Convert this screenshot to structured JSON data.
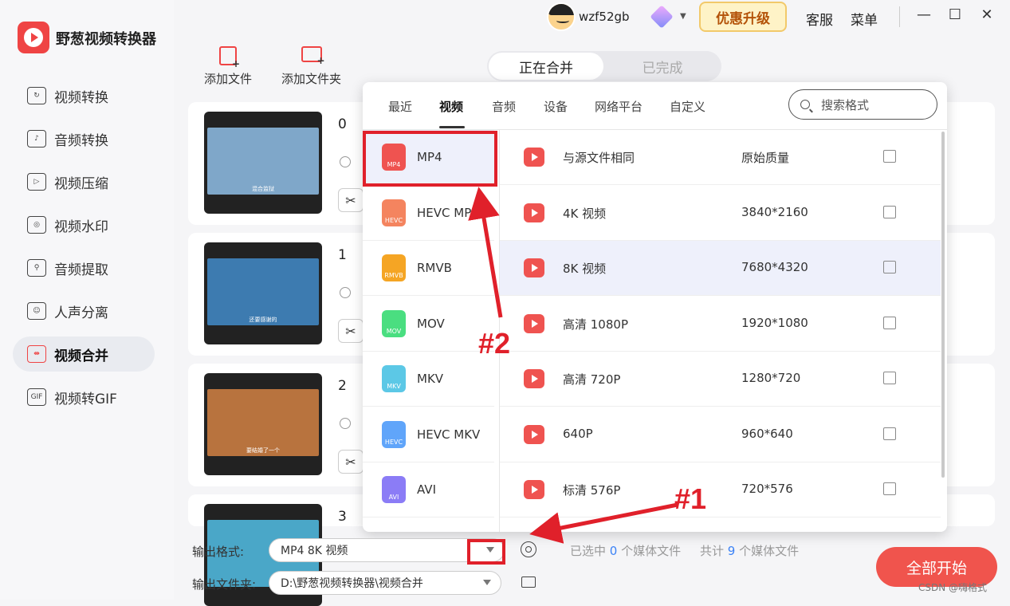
{
  "app": {
    "title": "野葱视频转换器"
  },
  "sidebar": {
    "items": [
      {
        "label": "视频转换",
        "icon": "video-convert-icon",
        "glyph": "↻"
      },
      {
        "label": "音频转换",
        "icon": "audio-convert-icon",
        "glyph": "♪"
      },
      {
        "label": "视频压缩",
        "icon": "video-compress-icon",
        "glyph": "▷"
      },
      {
        "label": "视频水印",
        "icon": "video-watermark-icon",
        "glyph": "◎"
      },
      {
        "label": "音频提取",
        "icon": "audio-extract-icon",
        "glyph": "⚲"
      },
      {
        "label": "人声分离",
        "icon": "voice-separate-icon",
        "glyph": "☺"
      },
      {
        "label": "视频合并",
        "icon": "video-merge-icon",
        "glyph": "⇹"
      },
      {
        "label": "视频转GIF",
        "icon": "gif-icon",
        "glyph": "GIF"
      }
    ],
    "active_index": 6
  },
  "titlebar": {
    "username": "wzf52gb",
    "vip_label": "优惠升级",
    "service_label": "客服",
    "menu_label": "菜单",
    "minimize": "—",
    "maximize": "☐",
    "close": "✕"
  },
  "toolbar": {
    "add_file": "添加文件",
    "add_folder": "添加文件夹"
  },
  "segment": {
    "merging": "正在合并",
    "done": "已完成"
  },
  "cards": [
    {
      "index": "0",
      "subtitle": "混合监狱"
    },
    {
      "index": "1",
      "subtitle": "还要感谢的"
    },
    {
      "index": "2",
      "subtitle": "要结婚了一个"
    },
    {
      "index": "3",
      "subtitle": ""
    }
  ],
  "popup": {
    "tabs": [
      "最近",
      "视频",
      "音频",
      "设备",
      "网络平台",
      "自定义"
    ],
    "active_tab": "视频",
    "search_placeholder": "搜索格式",
    "formats": [
      {
        "label": "MP4",
        "badge": "MP4",
        "color": "#ef5350"
      },
      {
        "label": "HEVC MP4",
        "badge": "HEVC",
        "color": "#f4845f"
      },
      {
        "label": "RMVB",
        "badge": "RMVB",
        "color": "#f5a524"
      },
      {
        "label": "MOV",
        "badge": "MOV",
        "color": "#4ade80"
      },
      {
        "label": "MKV",
        "badge": "MKV",
        "color": "#5cc8e6"
      },
      {
        "label": "HEVC MKV",
        "badge": "HEVC",
        "color": "#60a5fa"
      },
      {
        "label": "AVI",
        "badge": "AVI",
        "color": "#8b7cf6"
      }
    ],
    "selected_format": "MP4",
    "qualities": [
      {
        "name": "与源文件相同",
        "res": "原始质量"
      },
      {
        "name": "4K 视频",
        "res": "3840*2160"
      },
      {
        "name": "8K 视频",
        "res": "7680*4320"
      },
      {
        "name": "高清 1080P",
        "res": "1920*1080"
      },
      {
        "name": "高清 720P",
        "res": "1280*720"
      },
      {
        "name": "640P",
        "res": "960*640"
      },
      {
        "name": "标清 576P",
        "res": "720*576"
      }
    ],
    "highlighted_quality": "8K 视频"
  },
  "bottom": {
    "format_label": "输出格式:",
    "format_value": "MP4 8K 视频",
    "folder_label": "输出文件夹:",
    "folder_value": "D:\\野葱视频转换器\\视频合并",
    "selected_prefix": "已选中",
    "selected_count": "0",
    "selected_suffix": "个媒体文件",
    "total_prefix": "共计",
    "total_count": "9",
    "total_suffix": "个媒体文件",
    "start_label": "全部开始"
  },
  "annotations": {
    "label_1": "#1",
    "label_2": "#2",
    "color": "#e0202a"
  },
  "watermark": "CSDN @嗨格式"
}
